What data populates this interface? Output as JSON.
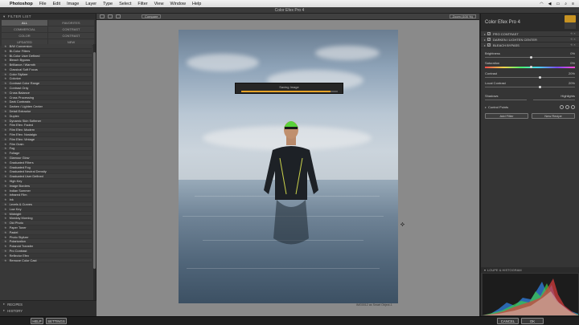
{
  "menubar": {
    "app_name": "Photoshop",
    "items": [
      "File",
      "Edit",
      "Image",
      "Layer",
      "Type",
      "Select",
      "Filter",
      "View",
      "Window",
      "Help"
    ]
  },
  "window": {
    "title": "Color Efex Pro 4"
  },
  "left_panel": {
    "header": "FILTER LIST",
    "categories": [
      {
        "label": "ALL",
        "active": true
      },
      {
        "label": "FAVORITES",
        "active": false
      },
      {
        "label": "COMMERCIAL",
        "active": false
      },
      {
        "label": "CONTRAST",
        "active": false
      },
      {
        "label": "COLOR",
        "active": false
      },
      {
        "label": "CONTRAST",
        "active": false
      },
      {
        "label": "UPDATED",
        "active": false
      },
      {
        "label": "NEW",
        "active": false
      }
    ],
    "filters": [
      "B/W Conversion",
      "Bi-Color Filters",
      "Bi-Color User Defined",
      "Bleach Bypass",
      "Brilliance / Warmth",
      "Classical Soft Focus",
      "Color Stylizer",
      "Colorize",
      "Contrast Color Range",
      "Contrast Only",
      "Cross Balance",
      "Cross Processing",
      "Dark Contrasts",
      "Darken / Lighten Center",
      "Detail Extractor",
      "Duplex",
      "Dynamic Skin Softener",
      "Film Efex: Faded",
      "Film Efex: Modern",
      "Film Efex: Nostalgic",
      "Film Efex: Vintage",
      "Film Grain",
      "Fog",
      "Foliage",
      "Glamour Glow",
      "Graduated Filters",
      "Graduated Fog",
      "Graduated Neutral Density",
      "Graduated User Defined",
      "High Key",
      "Image Borders",
      "Indian Summer",
      "Infrared Film",
      "Ink",
      "Levels & Curves",
      "Low Key",
      "Midnight",
      "Monday Morning",
      "Old Photo",
      "Paper Toner",
      "Pastel",
      "Photo Stylizer",
      "Polarization",
      "Polaroid Transfer",
      "Pro Contrast",
      "Reflector Efex",
      "Remove Color Cast"
    ],
    "footer": {
      "recipes": "RECIPES",
      "history": "HISTORY"
    }
  },
  "toolbar": {
    "compare_label": "Compare",
    "zoom_label": "Zoom (100 %)"
  },
  "progress": {
    "label": "Saving Image",
    "fraction": 0.93
  },
  "image_caption": {
    "line1": "IMG0012 as Smart Object-1",
    "line2": ""
  },
  "right_panel": {
    "title": "Color Efex Pro 4",
    "presets": [
      "PRO CONTRAST",
      "DARKEN / LIGHTEN CENTER",
      "BLEACH BYPASS"
    ],
    "sliders": [
      {
        "label": "Brightness",
        "value": "0%",
        "level": 0.5,
        "rainbow": false
      },
      {
        "label": "Saturation",
        "value": "0%",
        "level": 0.5,
        "rainbow": true
      },
      {
        "label": "Contrast",
        "value": "20%",
        "level": 0.6,
        "rainbow": false
      },
      {
        "label": "Local Contrast",
        "value": "20%",
        "level": 0.6,
        "rainbow": false
      }
    ],
    "shadows_label": "Shadows",
    "highlights_label": "Highlights",
    "control_points_label": "Control Points",
    "add_filter_label": "Add Filter",
    "new_recipe_label": "New Recipe",
    "loupe_label": "LOUPE & HISTOGRAM"
  },
  "bottom_bar": {
    "help": "HELP",
    "settings": "SETTINGS",
    "cancel": "CANCEL",
    "ok": "OK"
  },
  "colors": {
    "accent": "#e5a227",
    "panel": "#383838",
    "canvas": "#8a8a8a"
  }
}
